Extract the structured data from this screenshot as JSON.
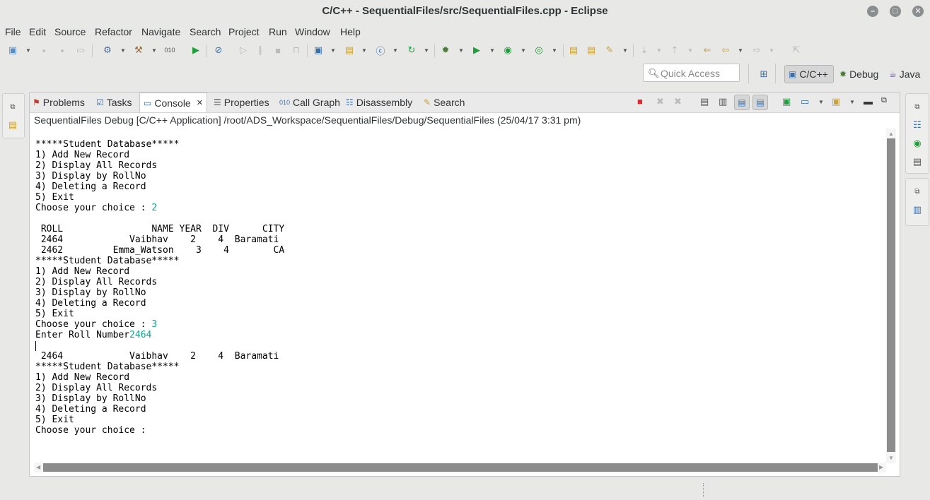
{
  "window": {
    "title": "C/C++ - SequentialFiles/src/SequentialFiles.cpp - Eclipse",
    "controls": [
      "minimize-icon",
      "maximize-icon",
      "close-icon"
    ]
  },
  "menu": [
    "File",
    "Edit",
    "Source",
    "Refactor",
    "Navigate",
    "Search",
    "Project",
    "Run",
    "Window",
    "Help"
  ],
  "quick_access": {
    "placeholder": "Quick Access"
  },
  "perspectives": [
    {
      "label": "C/C++",
      "active": true
    },
    {
      "label": "Debug",
      "active": false
    },
    {
      "label": "Java",
      "active": false
    }
  ],
  "tabs": [
    {
      "label": "Problems",
      "icon": "problems-icon"
    },
    {
      "label": "Tasks",
      "icon": "tasks-icon"
    },
    {
      "label": "Console",
      "icon": "console-icon",
      "active": true,
      "close": "✕"
    },
    {
      "label": "Properties",
      "icon": "properties-icon"
    },
    {
      "label": "Call Graph",
      "icon": "call-graph-icon"
    },
    {
      "label": "Disassembly",
      "icon": "disassembly-icon"
    },
    {
      "label": "Search",
      "icon": "search-icon"
    }
  ],
  "console": {
    "description": "SequentialFiles Debug [C/C++ Application] /root/ADS_Workspace/SequentialFiles/Debug/SequentialFiles (25/04/17 3:31 pm)",
    "lines": [
      "*****Student Database*****",
      "1) Add New Record",
      "2) Display All Records",
      "3) Display by RollNo",
      "4) Deleting a Record",
      "5) Exit",
      "Choose your choice : ",
      "",
      " ROLL                NAME YEAR  DIV      CITY",
      " 2464            Vaibhav    2    4  Baramati",
      " 2462         Emma_Watson    3    4        CA",
      "*****Student Database*****",
      "1) Add New Record",
      "2) Display All Records",
      "3) Display by RollNo",
      "4) Deleting a Record",
      "5) Exit",
      "Choose your choice : ",
      "Enter Roll Number",
      "",
      " 2464            Vaibhav    2    4  Baramati",
      "*****Student Database*****",
      "1) Add New Record",
      "2) Display All Records",
      "3) Display by RollNo",
      "4) Deleting a Record",
      "5) Exit",
      "Choose your choice : "
    ],
    "user_inputs": {
      "6": "2",
      "17": "3",
      "18": "2464"
    },
    "input_color": "#10a58f"
  },
  "colors": {
    "terminate_button": "#e0282d",
    "active_perspective_bg": "#d6d6d6"
  }
}
